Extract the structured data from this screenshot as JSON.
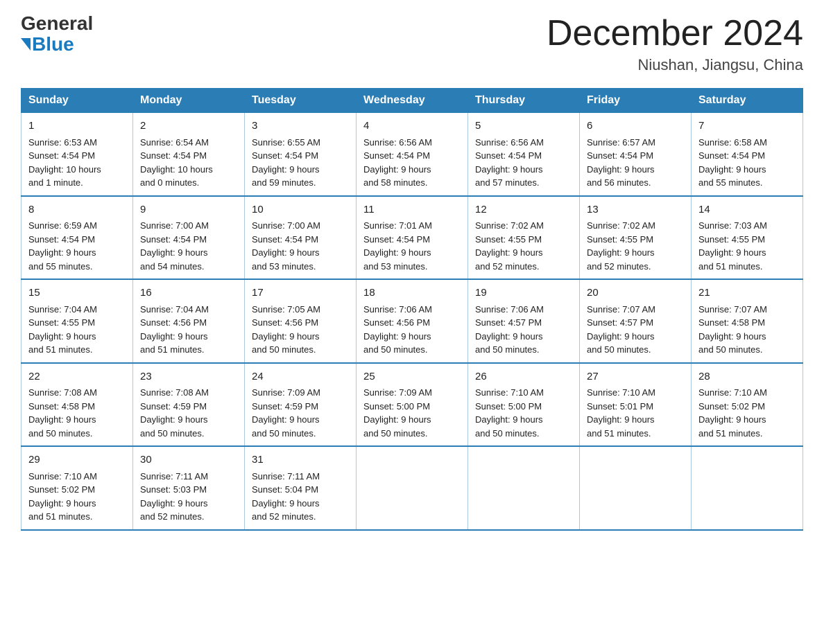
{
  "header": {
    "logo_general": "General",
    "logo_blue": "Blue",
    "month_title": "December 2024",
    "location": "Niushan, Jiangsu, China"
  },
  "weekdays": [
    "Sunday",
    "Monday",
    "Tuesday",
    "Wednesday",
    "Thursday",
    "Friday",
    "Saturday"
  ],
  "weeks": [
    [
      {
        "day": "1",
        "sunrise": "6:53 AM",
        "sunset": "4:54 PM",
        "daylight": "10 hours and 1 minute."
      },
      {
        "day": "2",
        "sunrise": "6:54 AM",
        "sunset": "4:54 PM",
        "daylight": "10 hours and 0 minutes."
      },
      {
        "day": "3",
        "sunrise": "6:55 AM",
        "sunset": "4:54 PM",
        "daylight": "9 hours and 59 minutes."
      },
      {
        "day": "4",
        "sunrise": "6:56 AM",
        "sunset": "4:54 PM",
        "daylight": "9 hours and 58 minutes."
      },
      {
        "day": "5",
        "sunrise": "6:56 AM",
        "sunset": "4:54 PM",
        "daylight": "9 hours and 57 minutes."
      },
      {
        "day": "6",
        "sunrise": "6:57 AM",
        "sunset": "4:54 PM",
        "daylight": "9 hours and 56 minutes."
      },
      {
        "day": "7",
        "sunrise": "6:58 AM",
        "sunset": "4:54 PM",
        "daylight": "9 hours and 55 minutes."
      }
    ],
    [
      {
        "day": "8",
        "sunrise": "6:59 AM",
        "sunset": "4:54 PM",
        "daylight": "9 hours and 55 minutes."
      },
      {
        "day": "9",
        "sunrise": "7:00 AM",
        "sunset": "4:54 PM",
        "daylight": "9 hours and 54 minutes."
      },
      {
        "day": "10",
        "sunrise": "7:00 AM",
        "sunset": "4:54 PM",
        "daylight": "9 hours and 53 minutes."
      },
      {
        "day": "11",
        "sunrise": "7:01 AM",
        "sunset": "4:54 PM",
        "daylight": "9 hours and 53 minutes."
      },
      {
        "day": "12",
        "sunrise": "7:02 AM",
        "sunset": "4:55 PM",
        "daylight": "9 hours and 52 minutes."
      },
      {
        "day": "13",
        "sunrise": "7:02 AM",
        "sunset": "4:55 PM",
        "daylight": "9 hours and 52 minutes."
      },
      {
        "day": "14",
        "sunrise": "7:03 AM",
        "sunset": "4:55 PM",
        "daylight": "9 hours and 51 minutes."
      }
    ],
    [
      {
        "day": "15",
        "sunrise": "7:04 AM",
        "sunset": "4:55 PM",
        "daylight": "9 hours and 51 minutes."
      },
      {
        "day": "16",
        "sunrise": "7:04 AM",
        "sunset": "4:56 PM",
        "daylight": "9 hours and 51 minutes."
      },
      {
        "day": "17",
        "sunrise": "7:05 AM",
        "sunset": "4:56 PM",
        "daylight": "9 hours and 50 minutes."
      },
      {
        "day": "18",
        "sunrise": "7:06 AM",
        "sunset": "4:56 PM",
        "daylight": "9 hours and 50 minutes."
      },
      {
        "day": "19",
        "sunrise": "7:06 AM",
        "sunset": "4:57 PM",
        "daylight": "9 hours and 50 minutes."
      },
      {
        "day": "20",
        "sunrise": "7:07 AM",
        "sunset": "4:57 PM",
        "daylight": "9 hours and 50 minutes."
      },
      {
        "day": "21",
        "sunrise": "7:07 AM",
        "sunset": "4:58 PM",
        "daylight": "9 hours and 50 minutes."
      }
    ],
    [
      {
        "day": "22",
        "sunrise": "7:08 AM",
        "sunset": "4:58 PM",
        "daylight": "9 hours and 50 minutes."
      },
      {
        "day": "23",
        "sunrise": "7:08 AM",
        "sunset": "4:59 PM",
        "daylight": "9 hours and 50 minutes."
      },
      {
        "day": "24",
        "sunrise": "7:09 AM",
        "sunset": "4:59 PM",
        "daylight": "9 hours and 50 minutes."
      },
      {
        "day": "25",
        "sunrise": "7:09 AM",
        "sunset": "5:00 PM",
        "daylight": "9 hours and 50 minutes."
      },
      {
        "day": "26",
        "sunrise": "7:10 AM",
        "sunset": "5:00 PM",
        "daylight": "9 hours and 50 minutes."
      },
      {
        "day": "27",
        "sunrise": "7:10 AM",
        "sunset": "5:01 PM",
        "daylight": "9 hours and 51 minutes."
      },
      {
        "day": "28",
        "sunrise": "7:10 AM",
        "sunset": "5:02 PM",
        "daylight": "9 hours and 51 minutes."
      }
    ],
    [
      {
        "day": "29",
        "sunrise": "7:10 AM",
        "sunset": "5:02 PM",
        "daylight": "9 hours and 51 minutes."
      },
      {
        "day": "30",
        "sunrise": "7:11 AM",
        "sunset": "5:03 PM",
        "daylight": "9 hours and 52 minutes."
      },
      {
        "day": "31",
        "sunrise": "7:11 AM",
        "sunset": "5:04 PM",
        "daylight": "9 hours and 52 minutes."
      },
      null,
      null,
      null,
      null
    ]
  ],
  "labels": {
    "sunrise": "Sunrise:",
    "sunset": "Sunset:",
    "daylight": "Daylight:"
  }
}
